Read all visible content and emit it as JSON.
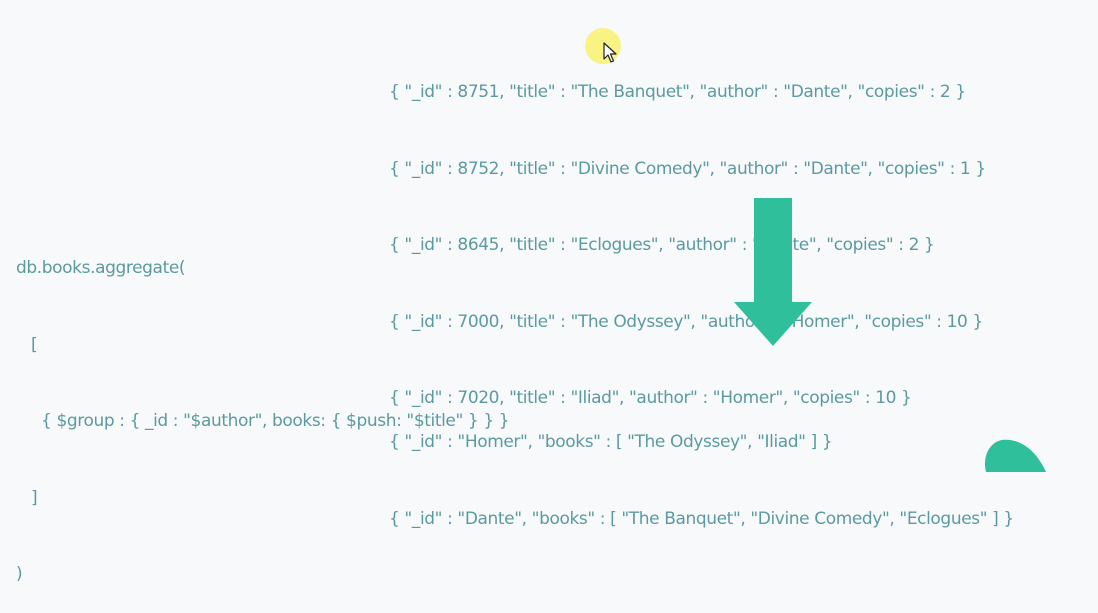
{
  "input_documents": [
    "{ \"_id\" : 8751, \"title\" : \"The Banquet\", \"author\" : \"Dante\", \"copies\" : 2 }",
    "{ \"_id\" : 8752, \"title\" : \"Divine Comedy\", \"author\" : \"Dante\", \"copies\" : 1 }",
    "{ \"_id\" : 8645, \"title\" : \"Eclogues\", \"author\" : \"Dante\", \"copies\" : 2 }",
    "{ \"_id\" : 7000, \"title\" : \"The Odyssey\", \"author\" : \"Homer\", \"copies\" : 10 }",
    "{ \"_id\" : 7020, \"title\" : \"Iliad\", \"author\" : \"Homer\", \"copies\" : 10 }"
  ],
  "query_lines": [
    "db.books.aggregate(",
    "   [",
    "     { $group : { _id : \"$author\", books: { $push: \"$title\" } } }",
    "   ]",
    ")"
  ],
  "output_documents": [
    "{ \"_id\" : \"Homer\", \"books\" : [ \"The Odyssey\", \"Iliad\" ] }",
    "{ \"_id\" : \"Dante\", \"books\" : [ \"The Banquet\", \"Divine Comedy\", \"Eclogues\" ] }"
  ],
  "colors": {
    "text": "#5b9aa0",
    "arrow": "#2fbf9b",
    "background": "#f7f9fb",
    "cursor_highlight": "#f8f05a",
    "leaf": "#2fbf9b"
  },
  "icons": {
    "arrow": "arrow-down-icon",
    "cursor": "mouse-cursor-icon",
    "leaf": "leaf-icon"
  }
}
